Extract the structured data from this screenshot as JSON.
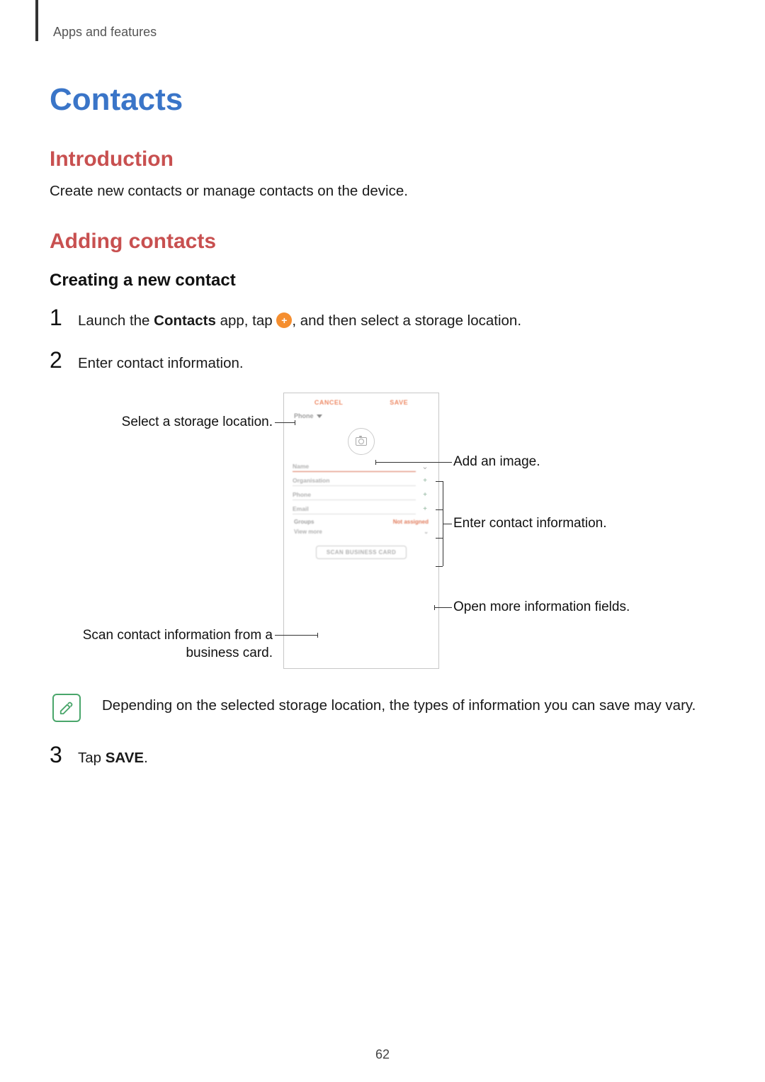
{
  "breadcrumb": "Apps and features",
  "title": "Contacts",
  "section_intro": "Introduction",
  "intro_text": "Create new contacts or manage contacts on the device.",
  "section_adding": "Adding contacts",
  "subsection_creating": "Creating a new contact",
  "step1": {
    "pre": "Launch the ",
    "app": "Contacts",
    "mid": " app, tap ",
    "post": ", and then select a storage location."
  },
  "step2": "Enter contact information.",
  "diagram": {
    "phone": {
      "cancel": "CANCEL",
      "save": "SAVE",
      "storage": "Phone",
      "fields": {
        "name": "Name",
        "organisation": "Organisation",
        "phone": "Phone",
        "email": "Email"
      },
      "groups_label": "Groups",
      "groups_value": "Not assigned",
      "view_more": "View more",
      "scan": "SCAN BUSINESS CARD"
    },
    "callouts": {
      "storage": "Select a storage location.",
      "image": "Add an image.",
      "info": "Enter contact information.",
      "more": "Open more information fields.",
      "scan": "Scan contact information from a business card."
    }
  },
  "note": "Depending on the selected storage location, the types of information you can save may vary.",
  "step3": {
    "pre": "Tap ",
    "bold": "SAVE",
    "post": "."
  },
  "page_number": "62"
}
